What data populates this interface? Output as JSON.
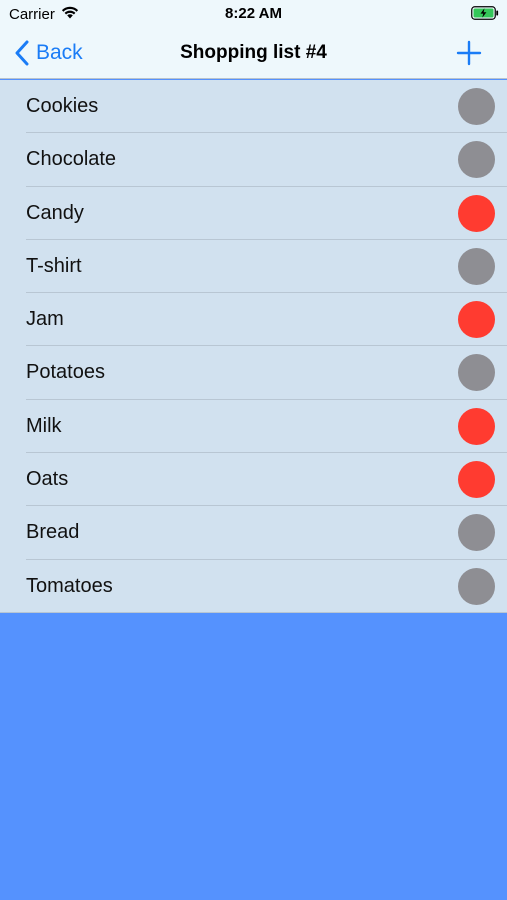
{
  "status_bar": {
    "carrier": "Carrier",
    "time": "8:22 AM"
  },
  "nav": {
    "back_label": "Back",
    "title": "Shopping list #4",
    "add_icon": "plus-icon"
  },
  "colors": {
    "accent": "#1a7cf6",
    "status_red": "#ff3b30",
    "status_gray": "#8e8e93",
    "list_bg": "#d1e1ef",
    "empty_bg": "#5592fe"
  },
  "items": [
    {
      "label": "Cookies",
      "status": "gray"
    },
    {
      "label": "Chocolate",
      "status": "gray"
    },
    {
      "label": "Candy",
      "status": "red"
    },
    {
      "label": "T-shirt",
      "status": "gray"
    },
    {
      "label": "Jam",
      "status": "red"
    },
    {
      "label": "Potatoes",
      "status": "gray"
    },
    {
      "label": "Milk",
      "status": "red"
    },
    {
      "label": "Oats",
      "status": "red"
    },
    {
      "label": "Bread",
      "status": "gray"
    },
    {
      "label": "Tomatoes",
      "status": "gray"
    }
  ]
}
